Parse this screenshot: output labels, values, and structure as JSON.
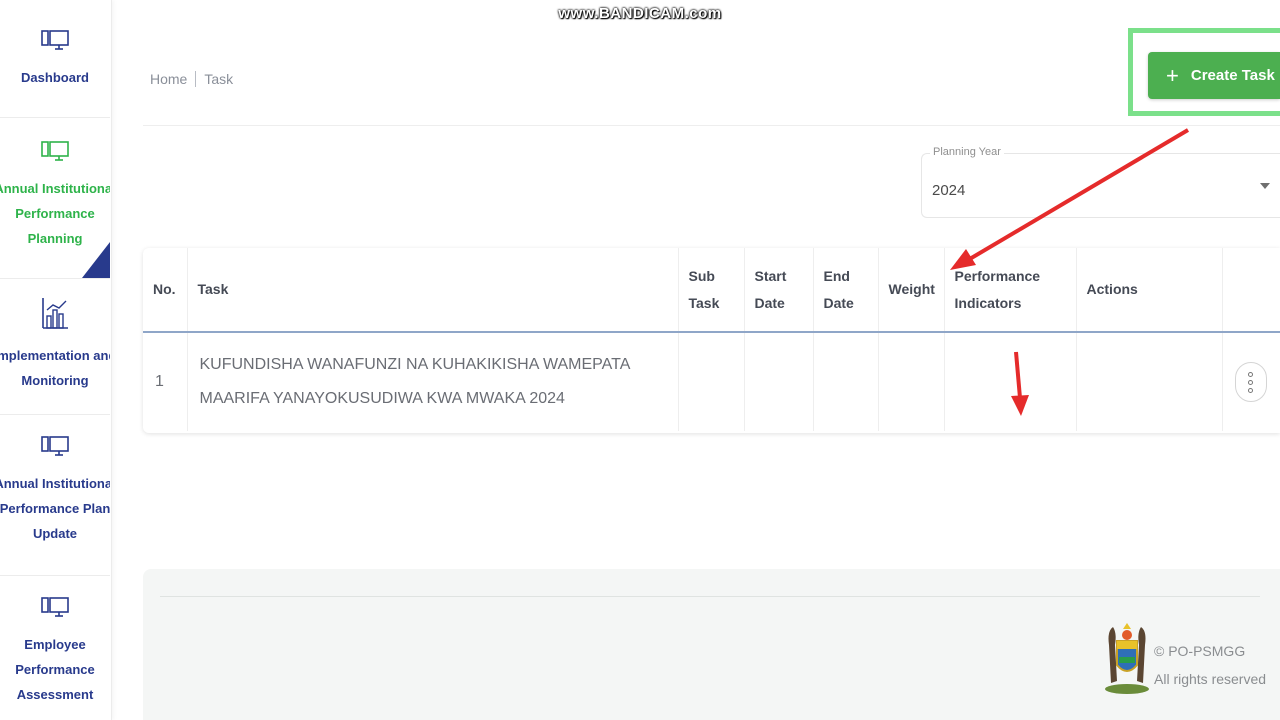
{
  "watermark": "www.BANDICAM.com",
  "sidebar": {
    "items": [
      {
        "label": "Dashboard"
      },
      {
        "label": "Annual Institutional Performance Planning"
      },
      {
        "label": "Implementation and Monitoring"
      },
      {
        "label": "Annual Institutional Performance Plan Update"
      },
      {
        "label": "Employee Performance Assessment"
      }
    ],
    "label_lines": {
      "dashboard": [
        "Dashboard"
      ],
      "planning": [
        "Annual Institutional",
        "Performance",
        "Planning"
      ],
      "implementation": [
        "Implementation and",
        "Monitoring"
      ],
      "plan_update": [
        "Annual Institutional",
        "Performance Plan",
        "Update"
      ],
      "assessment": [
        "Employee",
        "Performance",
        "Assessment"
      ]
    },
    "active_color": "#2eb34a",
    "text_color": "#283a8c"
  },
  "breadcrumb": {
    "home": "Home",
    "current": "Task"
  },
  "create_button": {
    "icon": "plus-icon",
    "label": "Create Task",
    "color": "#4caf50"
  },
  "planning_year": {
    "label": "Planning Year",
    "value": "2024"
  },
  "table": {
    "columns": {
      "no": "No.",
      "task": "Task",
      "sub_task": [
        "Sub",
        "Task"
      ],
      "start_date": [
        "Start",
        "Date"
      ],
      "end_date": [
        "End",
        "Date"
      ],
      "weight": "Weight",
      "performance_indicators": [
        "Performance",
        "Indicators"
      ],
      "actions": "Actions"
    },
    "rows": [
      {
        "no": "1",
        "task_lines": [
          "KUFUNDISHA WANAFUNZI NA KUHAKIKISHA WAMEPATA",
          "MAARIFA YANAYOKUSUDIWA KWA MWAKA 2024"
        ],
        "sub_task": "",
        "start_date": "",
        "end_date": "",
        "weight": "",
        "performance_indicators": "",
        "actions_icon": "more-vertical-icon"
      }
    ]
  },
  "footer": {
    "copyright": "© PO-PSMGG",
    "rights": "All rights reserved",
    "emblem": "coat-of-arms-icon"
  },
  "annotations": {
    "arrow_color": "#e52b2b"
  }
}
